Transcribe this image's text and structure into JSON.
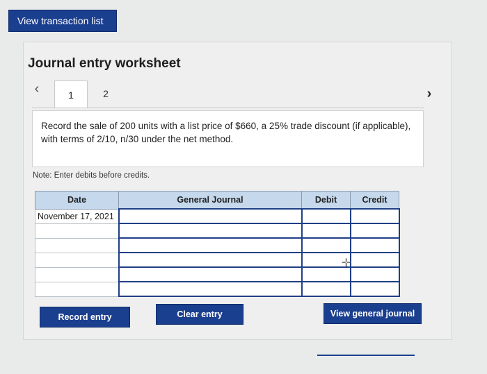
{
  "top_button": {
    "label": "View transaction list"
  },
  "worksheet": {
    "title": "Journal entry worksheet",
    "tabs": [
      {
        "label": "1"
      },
      {
        "label": "2"
      }
    ],
    "instruction": "Record the sale of 200 units with a list price of $660, a 25% trade discount (if applicable), with terms of 2/10, n/30 under the net method.",
    "note": "Note: Enter debits before credits."
  },
  "table": {
    "headers": {
      "date": "Date",
      "general_journal": "General Journal",
      "debit": "Debit",
      "credit": "Credit"
    },
    "rows": [
      {
        "date": "November 17, 2021",
        "account": "",
        "debit": "",
        "credit": ""
      },
      {
        "date": "",
        "account": "",
        "debit": "",
        "credit": ""
      },
      {
        "date": "",
        "account": "",
        "debit": "",
        "credit": ""
      },
      {
        "date": "",
        "account": "",
        "debit": "",
        "credit": ""
      },
      {
        "date": "",
        "account": "",
        "debit": "",
        "credit": ""
      },
      {
        "date": "",
        "account": "",
        "debit": "",
        "credit": ""
      }
    ]
  },
  "buttons": {
    "record": "Record entry",
    "clear": "Clear entry",
    "view_general_journal": "View general journal"
  },
  "icons": {
    "prev": "chevron-left-icon",
    "next": "chevron-right-icon"
  },
  "colors": {
    "accent": "#1b3f8f",
    "header_bg": "#c6d9ec"
  }
}
